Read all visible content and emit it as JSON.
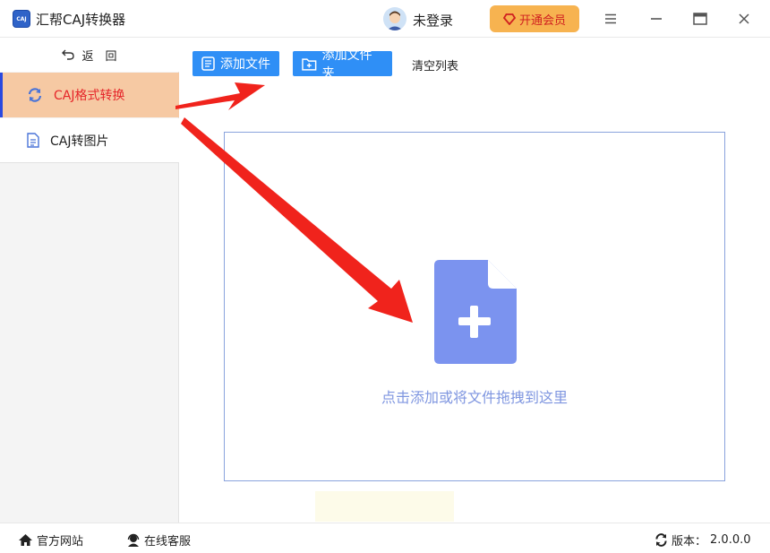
{
  "app": {
    "title": "汇帮CAJ转换器",
    "logo_text": "CAJ"
  },
  "user": {
    "name": "未登录"
  },
  "vip": {
    "label": "开通会员"
  },
  "sidebar": {
    "back_label": "返　回",
    "items": [
      {
        "label": "CAJ格式转换",
        "active": true
      },
      {
        "label": "CAJ转图片",
        "active": false
      }
    ]
  },
  "toolbar": {
    "add_file": "添加文件",
    "add_folder": "添加文件夹",
    "clear_list": "清空列表"
  },
  "dropzone": {
    "hint": "点击添加或将文件拖拽到这里"
  },
  "footer": {
    "website": "官方网站",
    "support": "在线客服",
    "version_label": "版本：",
    "version": "2.0.0.0"
  },
  "colors": {
    "accent_blue": "#2f8ff6",
    "active_bg": "#f6c9a3",
    "active_text": "#e5262a",
    "vip_bg": "#f7b350",
    "drop_icon": "#7b93ef",
    "arrow": "#f0231c"
  }
}
